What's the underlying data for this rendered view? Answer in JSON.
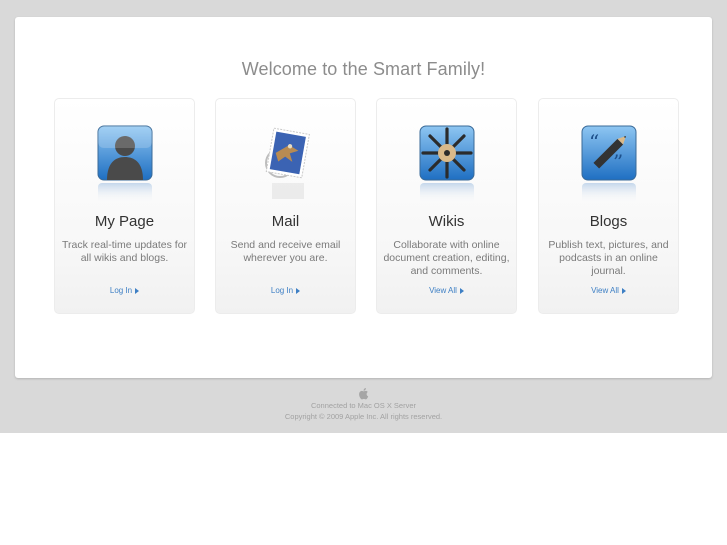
{
  "page": {
    "title": "Welcome to the Smart Family!"
  },
  "cards": [
    {
      "title": "My Page",
      "description": "Track real-time updates for all wikis and blogs.",
      "link": "Log In",
      "icon": "person-silhouette-icon"
    },
    {
      "title": "Mail",
      "description": "Send and receive email wherever you are.",
      "link": "Log In",
      "icon": "mail-stamp-eagle-icon"
    },
    {
      "title": "Wikis",
      "description": "Collaborate with online document creation, editing, and comments.",
      "link": "View All",
      "icon": "pencils-circle-icon"
    },
    {
      "title": "Blogs",
      "description": "Publish text, pictures, and podcasts in an online journal.",
      "link": "View All",
      "icon": "pencil-quote-icon"
    }
  ],
  "footer": {
    "line1": "Connected to Mac OS X Server",
    "line2": "Copyright © 2009 Apple Inc. All rights reserved.",
    "logo_icon": "apple-logo-icon"
  },
  "colors": {
    "background_band": "#d9d9d9",
    "panel": "#ffffff",
    "title_text": "#8c8c8c",
    "link": "#3d7fc4"
  }
}
